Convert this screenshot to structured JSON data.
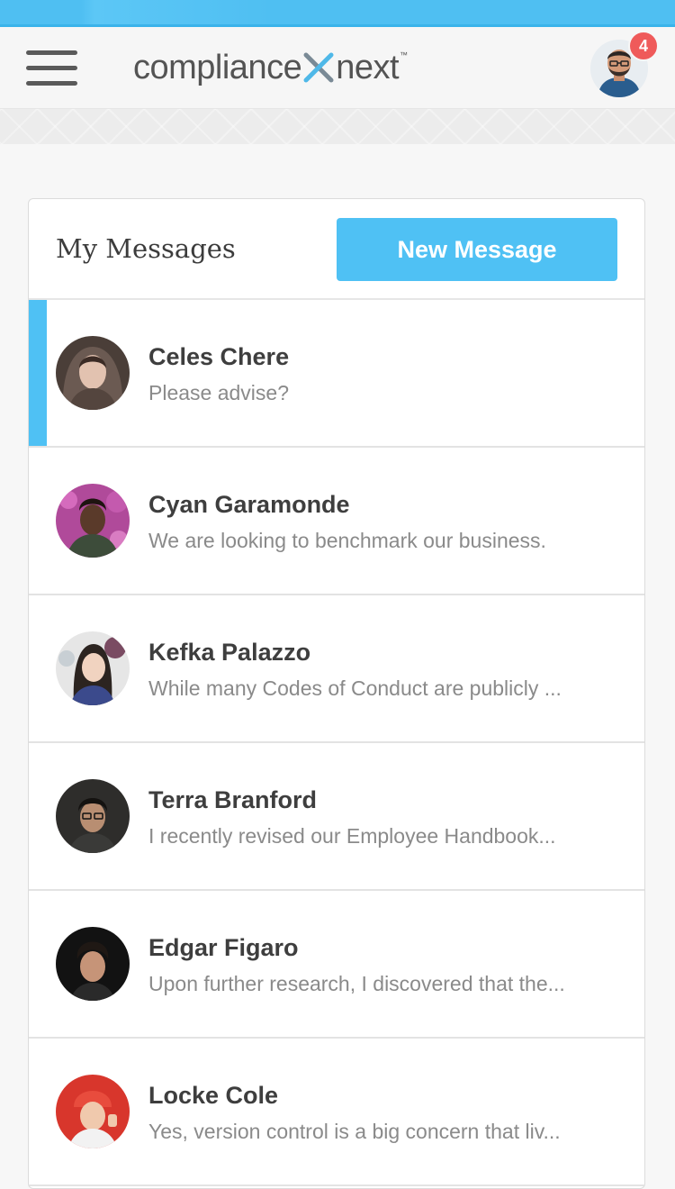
{
  "header": {
    "logo_left": "compliance",
    "logo_right": "next",
    "logo_tm": "™",
    "notification_count": "4"
  },
  "messages_panel": {
    "title": "My Messages",
    "new_button_label": "New Message"
  },
  "messages": [
    {
      "name": "Celes Chere",
      "preview": "Please advise?",
      "active": true
    },
    {
      "name": "Cyan Garamonde",
      "preview": "We are looking to benchmark our business.",
      "active": false
    },
    {
      "name": "Kefka Palazzo",
      "preview": "While many Codes of Conduct are publicly ...",
      "active": false
    },
    {
      "name": "Terra Branford",
      "preview": "I recently revised our Employee Handbook...",
      "active": false
    },
    {
      "name": "Edgar Figaro",
      "preview": "Upon further research, I discovered that the...",
      "active": false
    },
    {
      "name": "Locke Cole",
      "preview": "Yes, version control is a big concern that liv...",
      "active": false
    }
  ],
  "colors": {
    "accent": "#4fc1f4",
    "badge": "#ef5a5a",
    "logo_x_blue": "#4fb8e8",
    "logo_x_gray": "#7a8a96"
  },
  "icons": [
    "hamburger-menu-icon",
    "compliance-next-x-logo",
    "user-avatar",
    "notification-badge"
  ]
}
